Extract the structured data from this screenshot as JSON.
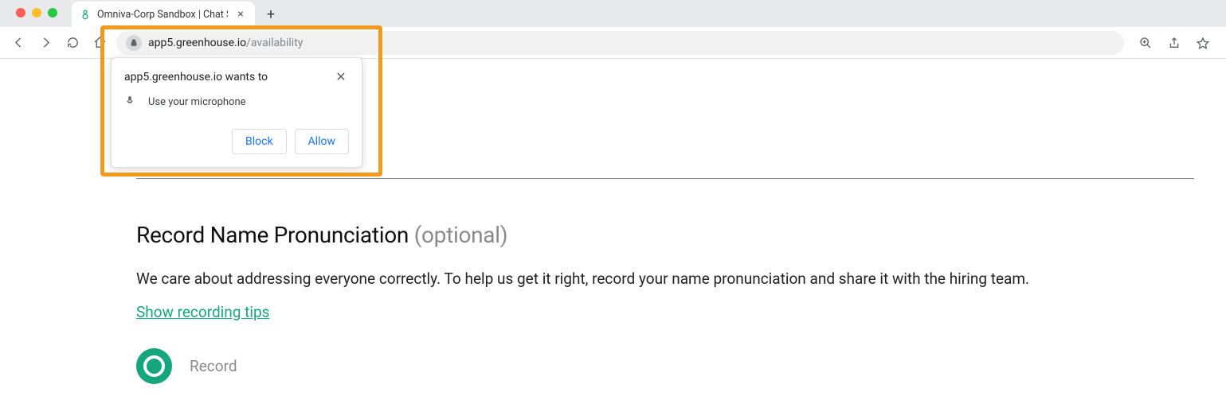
{
  "browser": {
    "tab": {
      "title": "Omniva-Corp Sandbox | Chat S"
    },
    "url": {
      "host": "app5.greenhouse.io",
      "path": "/availability"
    }
  },
  "permission": {
    "title": "app5.greenhouse.io wants to",
    "request": "Use your microphone",
    "block": "Block",
    "allow": "Allow"
  },
  "page": {
    "heading": "Record Name Pronunciation ",
    "heading_optional": "(optional)",
    "description": "We care about addressing everyone correctly. To help us get it right, record your name pronunciation and share it with the hiring team.",
    "show_tips": "Show recording tips",
    "record_label": "Record"
  }
}
